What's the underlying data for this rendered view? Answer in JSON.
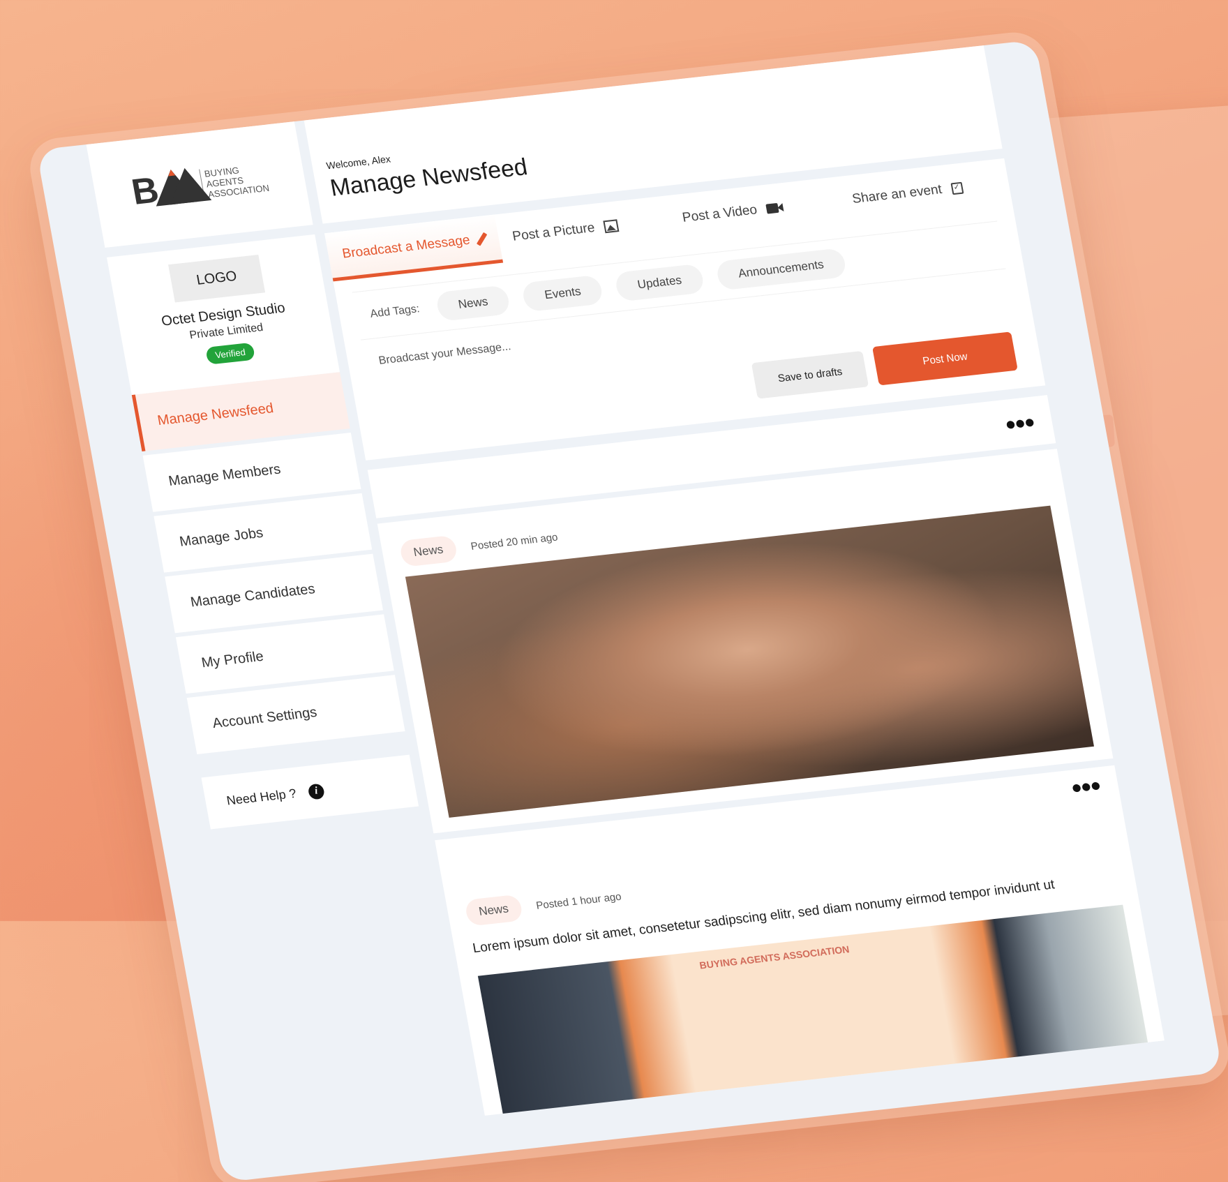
{
  "brand": {
    "name_lines": [
      "Buying",
      "Agents",
      "Association"
    ],
    "mark": "B"
  },
  "header": {
    "welcome": "Welcome, Alex",
    "title": "Manage Newsfeed"
  },
  "profile": {
    "logo_placeholder": "LOGO",
    "org_name": "Octet Design Studio",
    "org_sub": "Private Limited",
    "badge": "Verified"
  },
  "sidebar": {
    "items": [
      {
        "label": "Manage Newsfeed",
        "active": true
      },
      {
        "label": "Manage Members",
        "active": false
      },
      {
        "label": "Manage Jobs",
        "active": false
      },
      {
        "label": "Manage Candidates",
        "active": false
      },
      {
        "label": "My Profile",
        "active": false
      },
      {
        "label": "Account Settings",
        "active": false
      }
    ],
    "help_label": "Need Help ?",
    "help_icon": "info-icon"
  },
  "composer": {
    "tabs": [
      {
        "label": "Broadcast a Message",
        "icon": "pencil-icon",
        "active": true
      },
      {
        "label": "Post a Picture",
        "icon": "picture-icon",
        "active": false
      },
      {
        "label": "Post a Video",
        "icon": "video-icon",
        "active": false
      },
      {
        "label": "Share an event",
        "icon": "calendar-icon",
        "active": false
      }
    ],
    "tags_label": "Add Tags:",
    "tags": [
      "News",
      "Events",
      "Updates",
      "Announcements"
    ],
    "message_placeholder": "Broadcast your Message...",
    "message_value": "",
    "save_drafts_label": "Save to drafts",
    "post_now_label": "Post Now"
  },
  "feed": {
    "more_icon": "more-horizontal-icon",
    "posts": [
      {
        "tag": "News",
        "posted": "Posted 20 min ago",
        "text": "",
        "image": "hands-stacked-photo"
      },
      {
        "tag": "News",
        "posted": "Posted 1 hour ago",
        "text": "Lorem ipsum dolor sit amet, consetetur sadipscing elitr, sed diam nonumy eirmod tempor invidunt ut",
        "image": "buying-agents-association-expo-booth-photo",
        "image_banner": "BUYING AGENTS ASSOCIATION"
      }
    ]
  },
  "colors": {
    "accent": "#e4572e",
    "accent_light": "#fdeeea",
    "verified": "#22a33a",
    "background": "#f3a680",
    "panel": "#eef2f7"
  }
}
